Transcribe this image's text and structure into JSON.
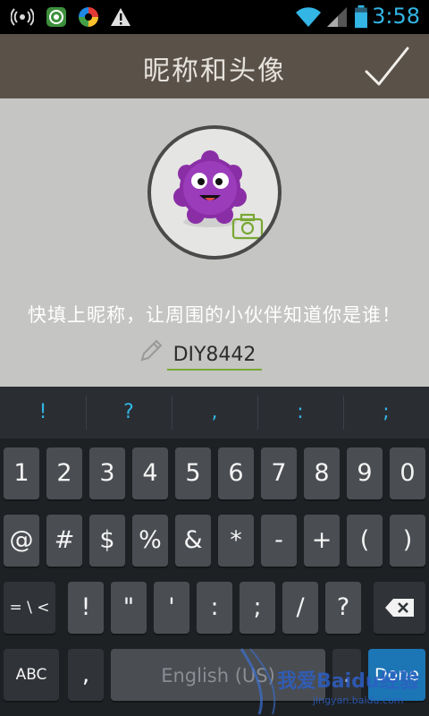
{
  "status_bar": {
    "time": "3:58",
    "icons": [
      "wifi-hotspot-icon",
      "app-notification-icon",
      "browser-notification-icon",
      "warning-icon",
      "wifi-icon",
      "signal-icon",
      "battery-icon"
    ],
    "accent_color": "#33b5e5"
  },
  "header": {
    "title": "昵称和头像",
    "confirm_icon": "checkmark-icon"
  },
  "profile": {
    "avatar_icon": "purple-monster-avatar",
    "camera_icon": "camera-icon",
    "prompt": "快填上昵称，让周围的小伙伴知道你是谁！",
    "nickname_value": "DIY8442",
    "edit_icon": "pencil-icon",
    "underline_color": "#78a733"
  },
  "keyboard": {
    "suggestions": [
      "!",
      "?",
      ",",
      ":",
      ";"
    ],
    "row1": [
      "1",
      "2",
      "3",
      "4",
      "5",
      "6",
      "7",
      "8",
      "9",
      "0"
    ],
    "row2": [
      "@",
      "#",
      "$",
      "%",
      "&",
      "*",
      "-",
      "+",
      "(",
      ")"
    ],
    "row3": {
      "shift_label": "= \\ <",
      "keys": [
        "!",
        "\"",
        "'",
        ":",
        ";",
        "/",
        "?"
      ],
      "delete_icon": "backspace-icon"
    },
    "row4": {
      "abc_label": "ABC",
      "comma_label": ",",
      "comma_sub": "...",
      "space_label": "English (US)",
      "period_label": ".",
      "done_label": "Done"
    }
  },
  "watermark": {
    "text": "我爱Baidu经验",
    "url": "jingyan.baidu.com"
  }
}
